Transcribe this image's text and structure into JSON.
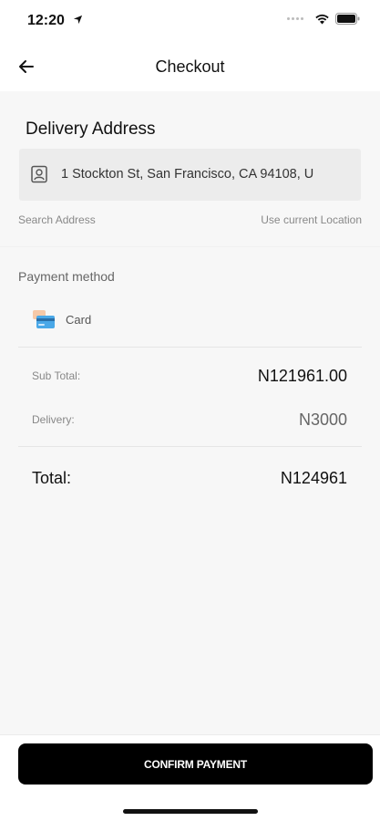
{
  "status_bar": {
    "time": "12:20",
    "icons": [
      "location-arrow-icon",
      "cellular-dots-icon",
      "wifi-icon",
      "battery-icon"
    ]
  },
  "nav": {
    "title": "Checkout",
    "back_icon": "back-arrow-icon"
  },
  "delivery": {
    "heading": "Delivery Address",
    "address_value": "1 Stockton St, San Francisco, CA  94108, U",
    "address_icon": "contact-card-icon",
    "search_address": "Search Address",
    "use_location": "Use current Location"
  },
  "payment": {
    "label": "Payment method",
    "method_label": "Card",
    "method_icon": "credit-card-icon"
  },
  "summary": {
    "subtotal_label": "Sub Total:",
    "subtotal_value": "N121961.00",
    "delivery_label": "Delivery:",
    "delivery_value": "N3000",
    "total_label": "Total:",
    "total_value": "N124961"
  },
  "actions": {
    "confirm_label": "CONFIRM PAYMENT"
  },
  "colors": {
    "background": "#f7f7f7",
    "primary_button": "#000000",
    "address_box": "#ececec"
  }
}
